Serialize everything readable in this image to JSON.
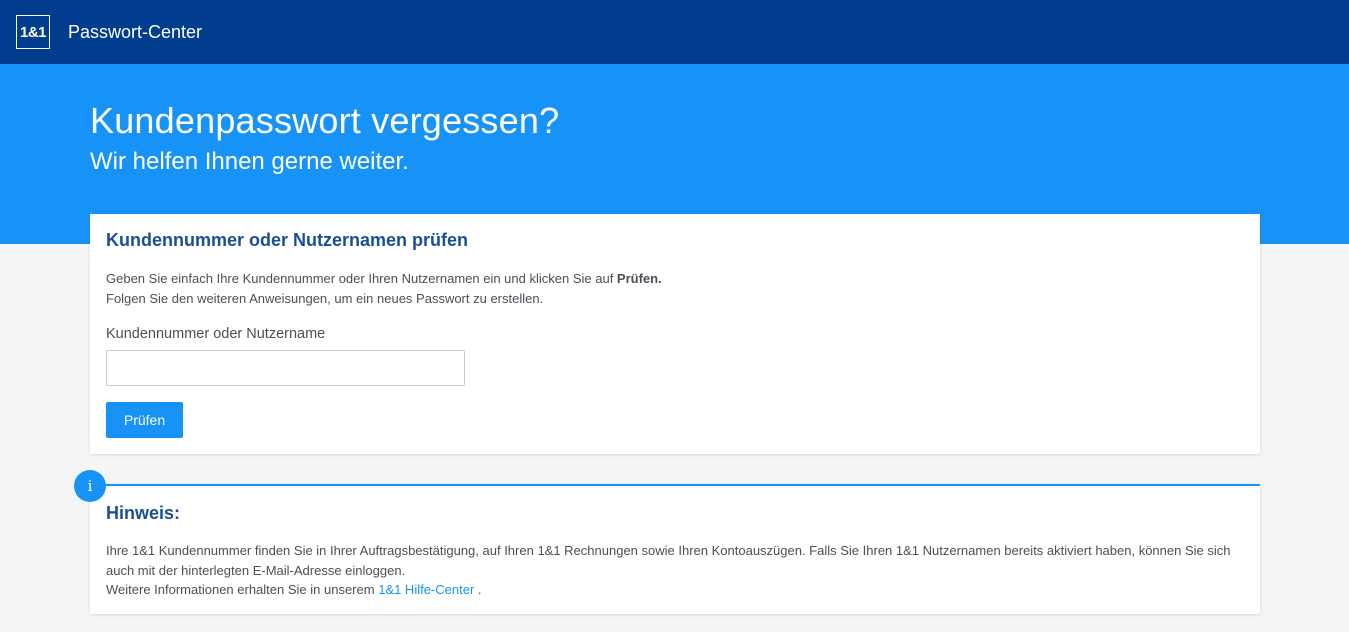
{
  "header": {
    "logo_text": "1&1",
    "app_title": "Passwort-Center"
  },
  "hero": {
    "title": "Kundenpasswort vergessen?",
    "subtitle": "Wir helfen Ihnen gerne weiter."
  },
  "form_card": {
    "title": "Kundennummer oder Nutzernamen prüfen",
    "text_line1_prefix": "Geben Sie einfach Ihre Kundennummer oder Ihren Nutzernamen ein und klicken Sie auf ",
    "text_line1_bold": "Prüfen.",
    "text_line2": "Folgen Sie den weiteren Anweisungen, um ein neues Passwort zu erstellen.",
    "field_label": "Kundennummer oder Nutzername",
    "field_value": "",
    "submit_label": "Prüfen"
  },
  "hint_card": {
    "badge": "i",
    "title": "Hinweis:",
    "text_line1": "Ihre 1&1 Kundennummer finden Sie in Ihrer Auftragsbestätigung, auf Ihren 1&1 Rechnungen sowie Ihren Kontoauszügen. Falls Sie Ihren 1&1 Nutzernamen bereits aktiviert haben, können Sie sich auch mit der hinterlegten E-Mail-Adresse einloggen.",
    "text_line2_prefix": "Weitere Informationen erhalten Sie in unserem ",
    "link_label": "1&1 Hilfe-Center",
    "text_line2_suffix": " ."
  },
  "colors": {
    "header_bg": "#003d8f",
    "hero_bg": "#1793f8",
    "accent": "#1793f8",
    "heading": "#1a4f94"
  }
}
